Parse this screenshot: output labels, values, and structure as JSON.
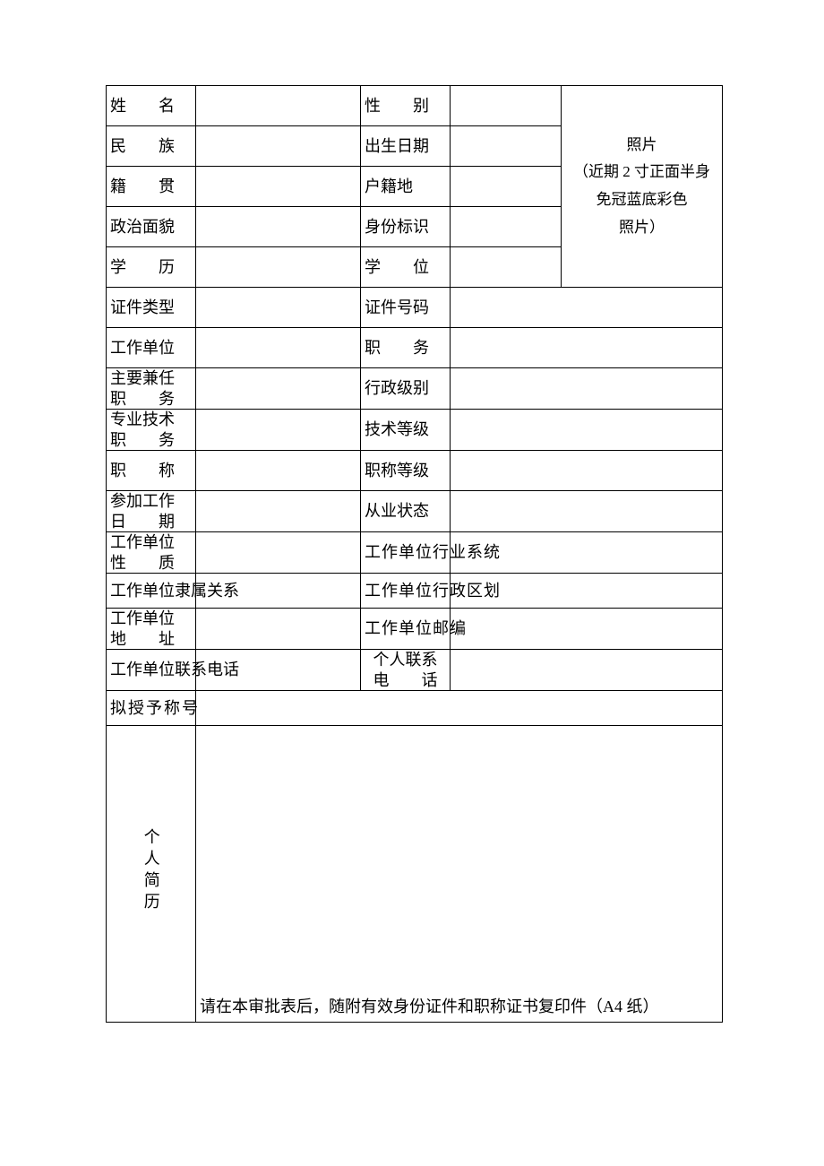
{
  "labels": {
    "name": "姓　　名",
    "gender": "性　　别",
    "ethnicity": "民　　族",
    "birth": "出生日期",
    "origin": "籍　　贯",
    "hukou": "户籍地",
    "politics": "政治面貌",
    "identity": "身份标识",
    "education": "学　　历",
    "degree": "学　　位",
    "idtype": "证件类型",
    "idnum": "证件号码",
    "employer": "工作单位",
    "position": "职　　务",
    "concurrent": "主要兼任\n职　　务",
    "admin_rank": "行政级别",
    "tech_post": "专业技术\n职　　务",
    "tech_grade": "技术等级",
    "title": "职　　称",
    "title_grade": "职称等级",
    "work_start": "参加工作\n日　　期",
    "work_status": "从业状态",
    "employer_nature": "工作单位\n性　　质",
    "employer_industry": "工作单位行业系统",
    "employer_affiliation": "工作单位隶属关系",
    "employer_region": "工作单位行政区划",
    "employer_address": "工作单位\n地　　址",
    "employer_zip": "工作单位邮编",
    "employer_phone": "工作单位联系电话",
    "personal_phone": "个人联系\n电　　话",
    "proposed_title": "拟授予称号",
    "resume": "个人简历"
  },
  "photo": {
    "line1": "照片",
    "line2": "（近期 2 寸正面半身",
    "line3": "免冠蓝底彩色",
    "line4": "照片）"
  },
  "values": {
    "name": "",
    "gender": "",
    "ethnicity": "",
    "birth": "",
    "origin": "",
    "hukou": "",
    "politics": "",
    "identity": "",
    "education": "",
    "degree": "",
    "idtype": "",
    "idnum": "",
    "employer": "",
    "position": "",
    "concurrent": "",
    "admin_rank": "",
    "tech_post": "",
    "tech_grade": "",
    "title": "",
    "title_grade": "",
    "work_start": "",
    "work_status": "",
    "employer_nature": "",
    "employer_industry": "",
    "employer_affiliation": "",
    "employer_region": "",
    "employer_address": "",
    "employer_zip": "",
    "employer_phone": "",
    "personal_phone": "",
    "proposed_title": "",
    "resume": ""
  },
  "footer_note": "请在本审批表后，随附有效身份证件和职称证书复印件（A4 纸）"
}
